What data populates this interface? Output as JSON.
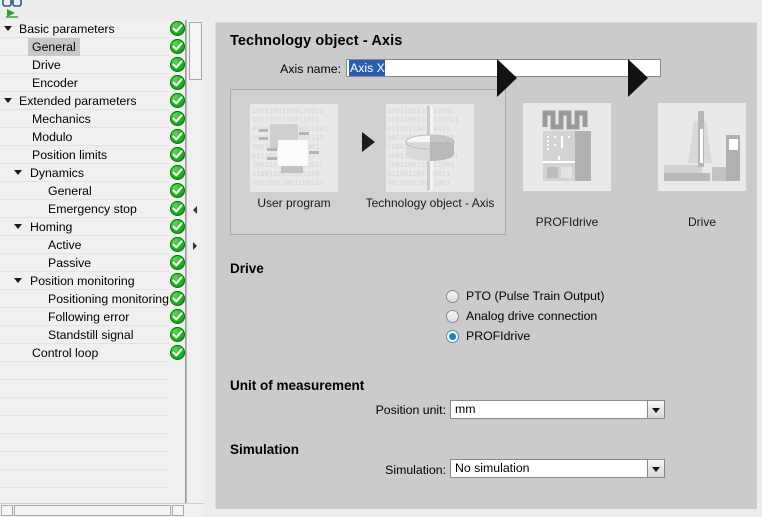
{
  "window": {
    "background_color": "#ededed",
    "panel_color": "#cbcbcb"
  },
  "toolbar": {
    "icons": [
      {
        "name": "goggles-icon",
        "label": "Goggles"
      },
      {
        "name": "play-icon",
        "label": "Go online"
      }
    ]
  },
  "sidebar": {
    "status_all_ok": true,
    "scrollbar": {
      "vertical": true,
      "horizontal": true
    },
    "items": [
      {
        "label": "Basic parameters",
        "level": 0,
        "expander": "down",
        "selected": false,
        "status": "ok"
      },
      {
        "label": "General",
        "level": 1,
        "expander": "",
        "selected": true,
        "status": "ok"
      },
      {
        "label": "Drive",
        "level": 1,
        "expander": "",
        "selected": false,
        "status": "ok"
      },
      {
        "label": "Encoder",
        "level": 1,
        "expander": "",
        "selected": false,
        "status": "ok"
      },
      {
        "label": "Extended parameters",
        "level": 0,
        "expander": "down",
        "selected": false,
        "status": "ok"
      },
      {
        "label": "Mechanics",
        "level": 1,
        "expander": "",
        "selected": false,
        "status": "ok"
      },
      {
        "label": "Modulo",
        "level": 1,
        "expander": "",
        "selected": false,
        "status": "ok"
      },
      {
        "label": "Position limits",
        "level": 1,
        "expander": "",
        "selected": false,
        "status": "ok"
      },
      {
        "label": "Dynamics",
        "level": 1,
        "expander": "down",
        "selected": false,
        "status": "ok"
      },
      {
        "label": "General",
        "level": 2,
        "expander": "",
        "selected": false,
        "status": "ok"
      },
      {
        "label": "Emergency stop",
        "level": 2,
        "expander": "",
        "selected": false,
        "status": "ok"
      },
      {
        "label": "Homing",
        "level": 1,
        "expander": "down",
        "selected": false,
        "status": "ok"
      },
      {
        "label": "Active",
        "level": 2,
        "expander": "",
        "selected": false,
        "status": "ok"
      },
      {
        "label": "Passive",
        "level": 2,
        "expander": "",
        "selected": false,
        "status": "ok"
      },
      {
        "label": "Position monitoring",
        "level": 1,
        "expander": "down",
        "selected": false,
        "status": "ok"
      },
      {
        "label": "Positioning monitoring",
        "level": 2,
        "expander": "",
        "selected": false,
        "status": "ok"
      },
      {
        "label": "Following error",
        "level": 2,
        "expander": "",
        "selected": false,
        "status": "ok"
      },
      {
        "label": "Standstill signal",
        "level": 2,
        "expander": "",
        "selected": false,
        "status": "ok"
      },
      {
        "label": "Control loop",
        "level": 1,
        "expander": "",
        "selected": false,
        "status": "ok"
      }
    ]
  },
  "main": {
    "title": "Technology object - Axis",
    "axis_name": {
      "label": "Axis name:",
      "value": "Axis X",
      "selected": true,
      "selection_color": "#2a5db0"
    },
    "diagram": {
      "tiles": [
        {
          "name": "user-program-icon",
          "caption": "User program"
        },
        {
          "name": "technology-object-axis-icon",
          "caption": "Technology object - Axis"
        },
        {
          "name": "profidrive-icon",
          "caption": "PROFIdrive"
        },
        {
          "name": "drive-icon",
          "caption": "Drive"
        }
      ],
      "arrows": 3
    },
    "drive_section": {
      "heading": "Drive",
      "options": [
        {
          "label": "PTO (Pulse Train Output)",
          "selected": false
        },
        {
          "label": "Analog drive connection",
          "selected": false
        },
        {
          "label": "PROFIdrive",
          "selected": true
        }
      ],
      "selected_color": "#1b86c4"
    },
    "unit_section": {
      "heading": "Unit of measurement",
      "field_label": "Position unit:",
      "value": "mm"
    },
    "simulation_section": {
      "heading": "Simulation",
      "field_label": "Simulation:",
      "value": "No simulation"
    }
  }
}
